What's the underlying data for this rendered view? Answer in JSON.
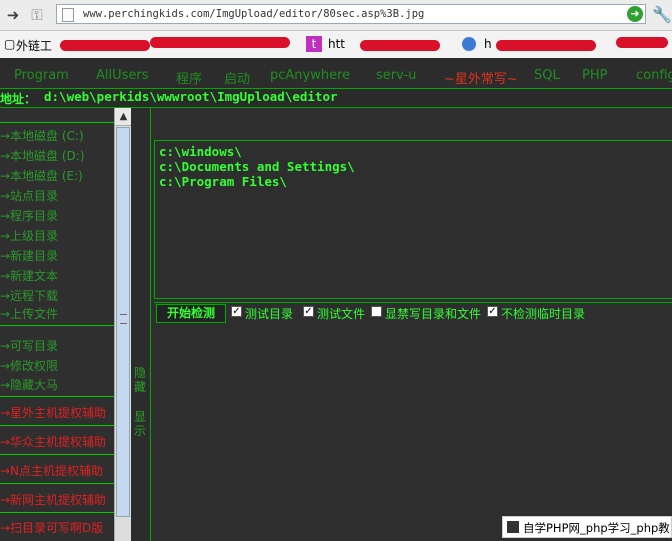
{
  "browser": {
    "url": "www.perchingkids.com/ImgUpload/editor/80sec.asp%3B.jpg",
    "icons": [
      "back-icon",
      "forward-icon",
      "page-icon",
      "go-icon",
      "wrench-icon"
    ]
  },
  "bookmarks": {
    "items": [
      {
        "label": "外链工",
        "icon": "bookmark-icon"
      },
      {
        "label": "t",
        "icon": "app-icon"
      },
      {
        "label": "htt",
        "icon": "link-icon"
      },
      {
        "label": "h",
        "icon": "globe-icon"
      }
    ]
  },
  "menu": {
    "items": [
      {
        "label": "Program",
        "color": "#1f8f1f"
      },
      {
        "label": "AllUsers",
        "color": "#1f8f1f"
      },
      {
        "label": "程序",
        "color": "#1f8f1f"
      },
      {
        "label": "启动",
        "color": "#1f8f1f"
      },
      {
        "label": "pcAnywhere",
        "color": "#1f8f1f"
      },
      {
        "label": "serv-u",
        "color": "#1f8f1f"
      },
      {
        "label": "~星外常写~",
        "color": "#e03020"
      },
      {
        "label": "SQL",
        "color": "#1f8f1f"
      },
      {
        "label": "PHP",
        "color": "#1f8f1f"
      },
      {
        "label": "config",
        "color": "#1f8f1f"
      }
    ]
  },
  "path": {
    "label": "地址：",
    "value": "d:\\web\\perkids\\wwwroot\\ImgUpload\\editor"
  },
  "sidebar": {
    "group1": [
      "→本地磁盘 (C:)",
      "→本地磁盘 (D:)",
      "→本地磁盘 (E:)",
      "→站点目录",
      "→程序目录",
      "→上级目录",
      "→新建目录",
      "→新建文本",
      "→远程下载",
      "→上传文件"
    ],
    "group2": [
      "→可写目录",
      "→修改权限",
      "→隐藏大马"
    ],
    "group3": [
      "→星外主机提权辅助",
      "→华众主机提权辅助",
      "→N点主机提权辅助",
      "→新网主机提权辅助",
      "→扫目录可写啊D版"
    ]
  },
  "toggle": {
    "hide": "隐藏",
    "show": "显示"
  },
  "drives": [
    "c:\\windows\\",
    "c:\\Documents and Settings\\",
    "c:\\Program Files\\"
  ],
  "options": {
    "scan_button": "开始检测",
    "checks": [
      {
        "label": "测试目录",
        "checked": true
      },
      {
        "label": "测试文件",
        "checked": true
      },
      {
        "label": "显禁写目录和文件",
        "checked": false
      },
      {
        "label": "不检测临时目录",
        "checked": true
      }
    ]
  },
  "watermark": {
    "text": "自学PHP网_php学习_php教"
  }
}
